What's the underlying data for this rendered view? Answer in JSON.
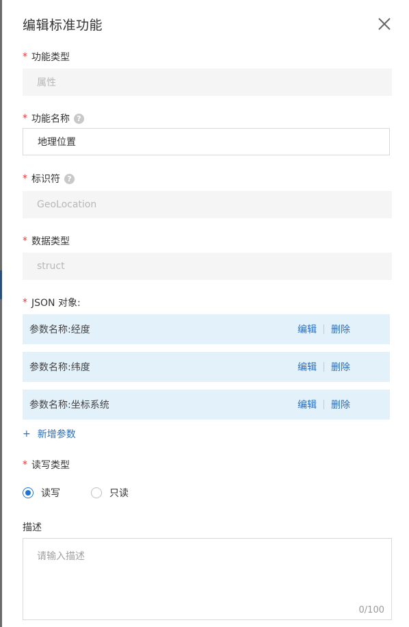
{
  "dialog": {
    "title": "编辑标准功能",
    "close_icon": "close-icon"
  },
  "required_mark": "*",
  "fields": {
    "feature_type": {
      "label": "功能类型",
      "value": "属性"
    },
    "feature_name": {
      "label": "功能名称",
      "value": "地理位置",
      "help_icon": "question-circle-icon"
    },
    "identifier": {
      "label": "标识符",
      "value": "GeoLocation",
      "help_icon": "question-circle-icon"
    },
    "data_type": {
      "label": "数据类型",
      "value": "struct"
    },
    "json_object": {
      "label": "JSON 对象:"
    }
  },
  "params": [
    {
      "text": "参数名称:经度",
      "edit": "编辑",
      "delete": "删除"
    },
    {
      "text": "参数名称:纬度",
      "edit": "编辑",
      "delete": "删除"
    },
    {
      "text": "参数名称:坐标系统",
      "edit": "编辑",
      "delete": "删除"
    }
  ],
  "add_param": {
    "icon": "plus-icon",
    "label": "新增参数"
  },
  "rw_type": {
    "label": "读写类型",
    "options": [
      {
        "label": "读写",
        "selected": true
      },
      {
        "label": "只读",
        "selected": false
      }
    ]
  },
  "description": {
    "label": "描述",
    "placeholder": "请输入描述",
    "counter": "0/100"
  },
  "colors": {
    "accent": "#1f74d4",
    "link": "#2a6ebb",
    "required": "#e4393c",
    "param_bg": "#e3f1fb",
    "disabled_bg": "#f5f5f5"
  }
}
